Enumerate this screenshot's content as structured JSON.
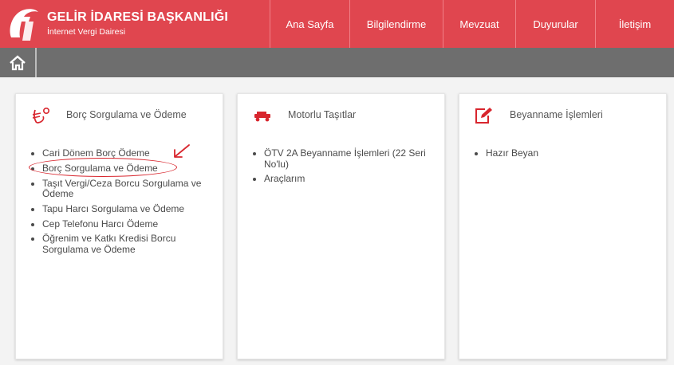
{
  "header": {
    "title": "GELİR İDARESİ BAŞKANLIĞI",
    "subtitle": "İnternet Vergi Dairesi",
    "logo_icon": "gib-logo-icon",
    "nav": [
      {
        "label": "Ana Sayfa"
      },
      {
        "label": "Bilgilendirme"
      },
      {
        "label": "Mevzuat"
      },
      {
        "label": "Duyurular"
      },
      {
        "label": "İletişim"
      }
    ]
  },
  "subnav": {
    "home_icon": "home-icon"
  },
  "cards": [
    {
      "title": "Borç Sorgulama ve Ödeme",
      "icon": "payment-icon",
      "items": [
        "Cari Dönem Borç Ödeme",
        "Borç Sorgulama ve Ödeme",
        "Taşıt Vergi/Ceza Borcu Sorgulama ve Ödeme",
        "Tapu Harcı Sorgulama ve Ödeme",
        "Cep Telefonu Harcı Ödeme",
        "Öğrenim ve Katkı Kredisi Borcu Sorgulama ve Ödeme"
      ]
    },
    {
      "title": "Motorlu Taşıtlar",
      "icon": "car-icon",
      "items": [
        "ÖTV 2A Beyanname İşlemleri (22 Seri No'lu)",
        "Araçlarım"
      ]
    },
    {
      "title": "Beyanname İşlemleri",
      "icon": "edit-document-icon",
      "items": [
        "Hazır Beyan"
      ]
    }
  ],
  "colors": {
    "brand_red": "#e0464f",
    "subbar_gray": "#6e6e6e",
    "background": "#f3f3f3",
    "annotation_red": "#d8262e"
  }
}
